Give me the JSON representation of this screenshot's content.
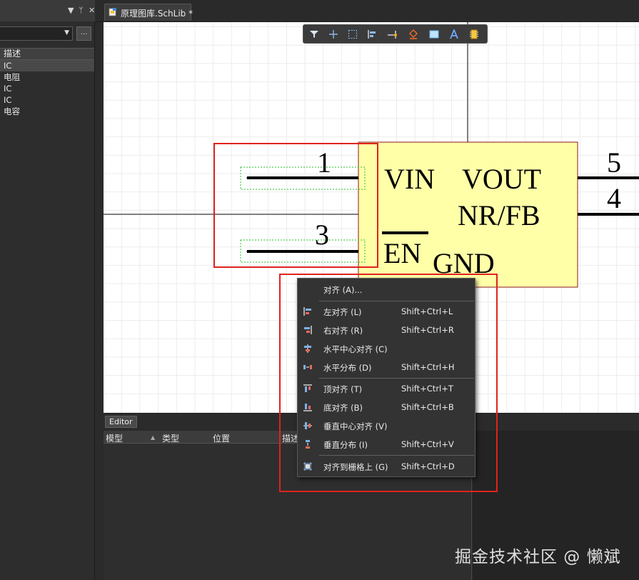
{
  "left_panel": {
    "column_header": "描述",
    "more_button": "...",
    "rows": [
      {
        "label": "IC",
        "selected": true
      },
      {
        "label": "电阻",
        "selected": false
      },
      {
        "label": "IC",
        "selected": false
      },
      {
        "label": "IC",
        "selected": false
      },
      {
        "label": "电容",
        "selected": false
      }
    ]
  },
  "document_tab": {
    "label": "原理图库.SchLib *"
  },
  "toolbar": {
    "icons": [
      "filter-icon",
      "crosshair-icon",
      "select-rect-icon",
      "align-icon",
      "place-pin-icon",
      "fill-icon",
      "rectangle-icon",
      "text-icon",
      "component-icon"
    ]
  },
  "schematic": {
    "pins": {
      "pin1": "1",
      "pin3": "3",
      "pin5": "5",
      "pin4": "4"
    },
    "labels": {
      "vin": "VIN",
      "vout": "VOUT",
      "nrfb": "NR/FB",
      "en": "EN",
      "gnd": "GND"
    },
    "colors": {
      "body_fill": "#ffffa8",
      "body_stroke": "#8b1a1a"
    }
  },
  "editor": {
    "tab_label": "Editor",
    "columns": [
      "模型",
      "类型",
      "位置",
      "描述"
    ]
  },
  "context_menu": {
    "items": [
      {
        "label": "对齐 (A)...",
        "shortcut": "",
        "icon": ""
      },
      {
        "label": "左对齐 (L)",
        "shortcut": "Shift+Ctrl+L",
        "icon": "align-left-icon"
      },
      {
        "label": "右对齐 (R)",
        "shortcut": "Shift+Ctrl+R",
        "icon": "align-right-icon"
      },
      {
        "label": "水平中心对齐 (C)",
        "shortcut": "",
        "icon": "align-horizontal-center-icon"
      },
      {
        "label": "水平分布 (D)",
        "shortcut": "Shift+Ctrl+H",
        "icon": "distribute-horizontal-icon"
      },
      {
        "label": "顶对齐 (T)",
        "shortcut": "Shift+Ctrl+T",
        "icon": "align-top-icon"
      },
      {
        "label": "底对齐 (B)",
        "shortcut": "Shift+Ctrl+B",
        "icon": "align-bottom-icon"
      },
      {
        "label": "垂直中心对齐 (V)",
        "shortcut": "",
        "icon": "align-vertical-center-icon"
      },
      {
        "label": "垂直分布 (I)",
        "shortcut": "Shift+Ctrl+V",
        "icon": "distribute-vertical-icon"
      },
      {
        "label": "对齐到栅格上 (G)",
        "shortcut": "Shift+Ctrl+D",
        "icon": "align-to-grid-icon"
      }
    ]
  },
  "watermark": "掘金技术社区 @ 懒斌",
  "highlight_color": "#e0231d"
}
